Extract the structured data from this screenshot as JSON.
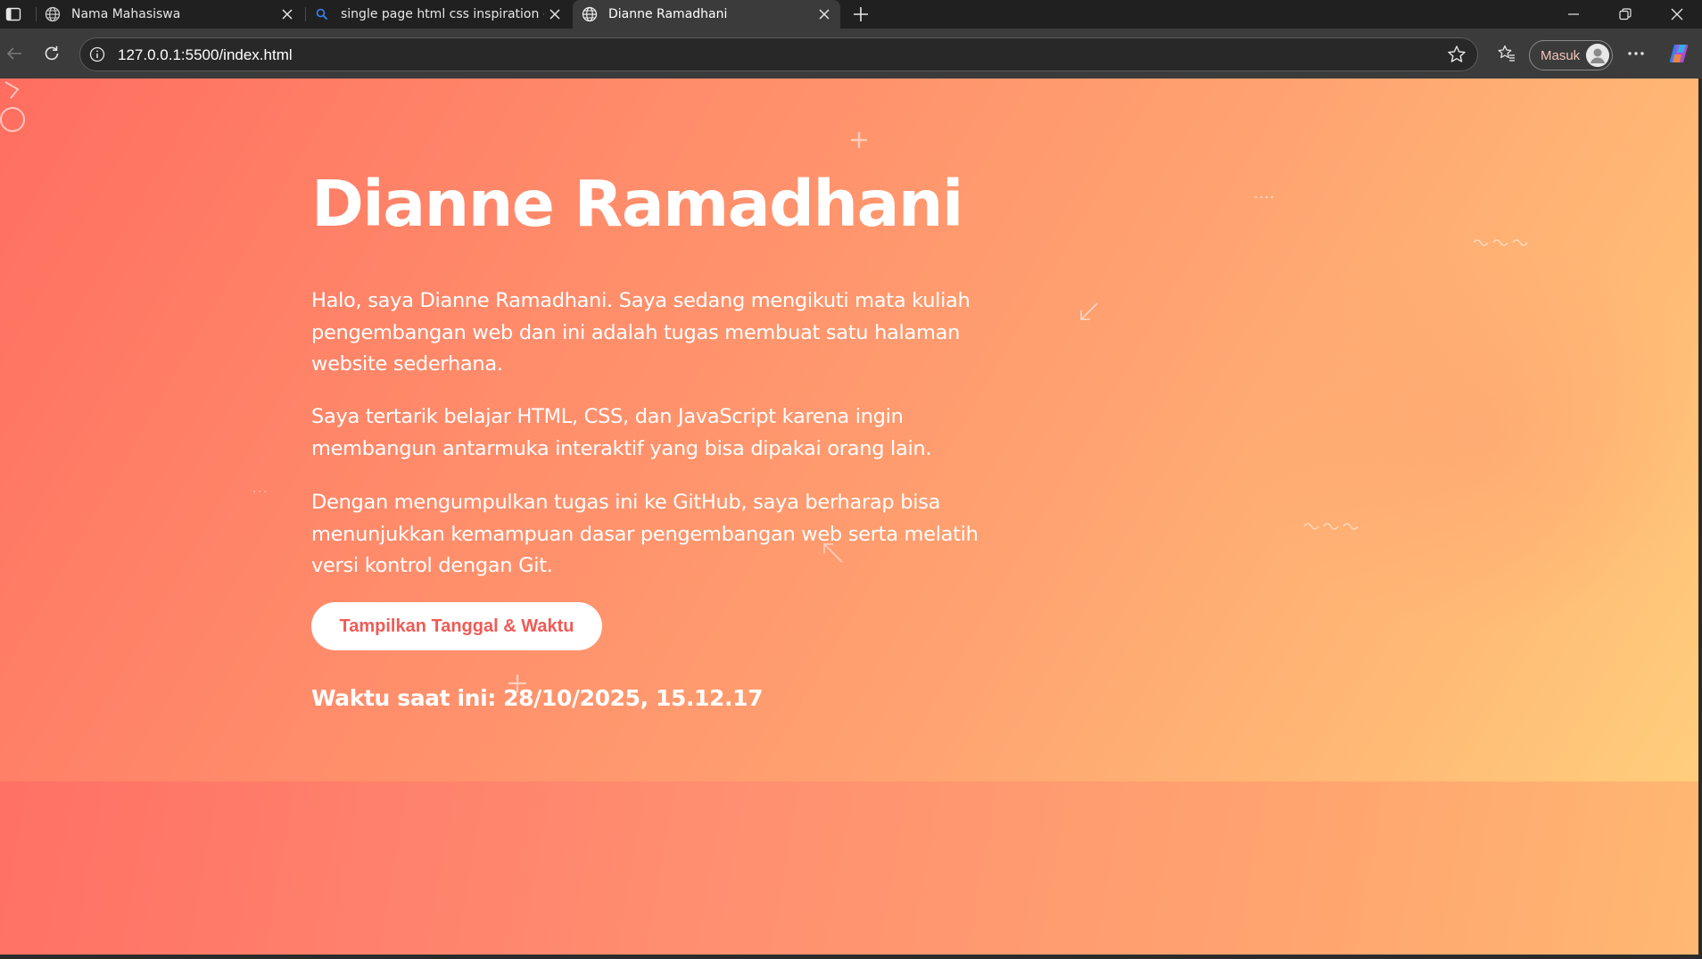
{
  "browser": {
    "tabs": [
      {
        "title": "Nama Mahasiswa",
        "active": false
      },
      {
        "title": "single page html css inspiration -",
        "active": false
      },
      {
        "title": "Dianne Ramadhani",
        "active": true
      }
    ],
    "url": "127.0.0.1:5500/index.html",
    "profile_label": "Masuk"
  },
  "page": {
    "title": "Dianne Ramadhani",
    "paragraphs": [
      "Halo, saya Dianne Ramadhani. Saya sedang mengikuti mata kuliah pengembangan web dan ini adalah tugas membuat satu halaman website sederhana.",
      "Saya tertarik belajar HTML, CSS, dan JavaScript karena ingin membangun antarmuka interaktif yang bisa dipakai orang lain.",
      "Dengan mengumpulkan tugas ini ke GitHub, saya berharap bisa menunjukkan kemampuan dasar pengembangan web serta melatih versi kontrol dengan Git."
    ],
    "button_label": "Tampilkan Tanggal & Waktu",
    "clock_text": "Waktu saat ini: 28/10/2025, 15.12.17"
  },
  "colors": {
    "gradient_start": "#ff6e60",
    "gradient_end": "#ffce7c",
    "button_text": "#f05a55",
    "text": "#ffffff"
  }
}
